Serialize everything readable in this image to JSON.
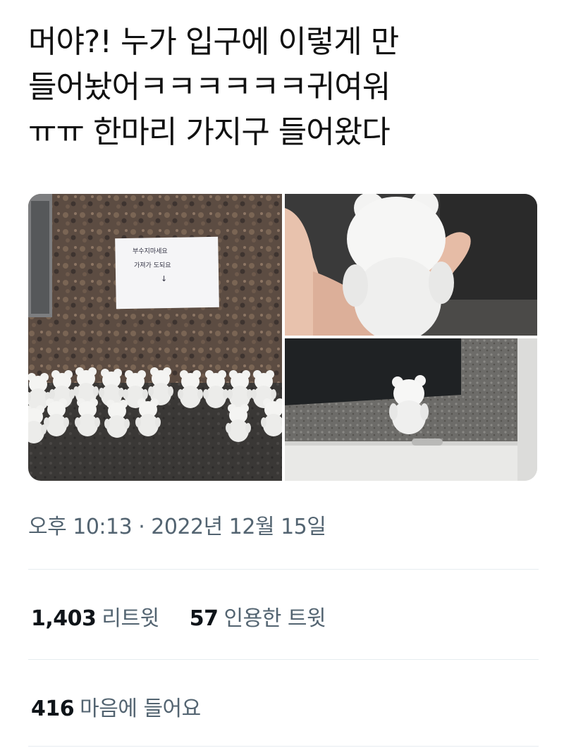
{
  "tweet": {
    "text": "머야?! 누가 입구에 이렇게 만\n들어놨어ㅋㅋㅋㅋㅋㅋ귀여워\nㅠㅠ 한마리 가지구 들어왔다",
    "timestamp": "오후 10:13 · 2022년 12월 15일"
  },
  "media": {
    "note_line1": "부수지마세요",
    "note_line2": "가져가 도되요",
    "note_arrow": "↓"
  },
  "stats": {
    "retweets": {
      "count": "1,403",
      "label": "리트윗"
    },
    "quotes": {
      "count": "57",
      "label": "인용한 트윗"
    },
    "likes": {
      "count": "416",
      "label": "마음에 들어요"
    }
  }
}
